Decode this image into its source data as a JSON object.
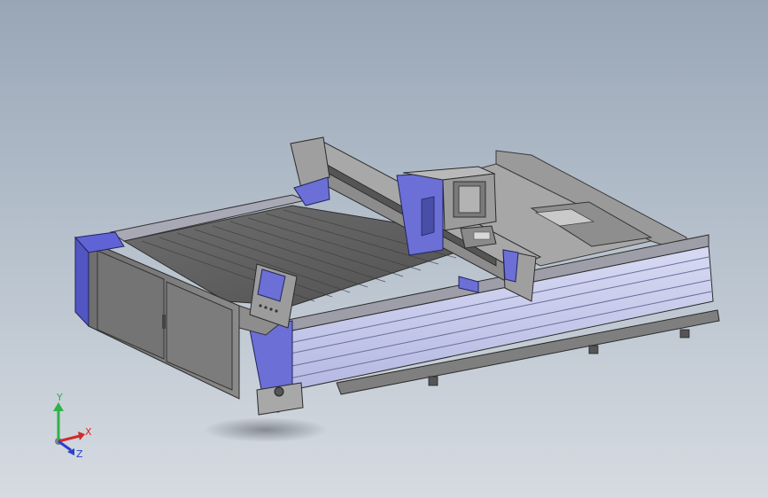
{
  "viewport": {
    "background_top": "#99a6b6",
    "background_bottom": "#d6dbe1",
    "model_accent_color": "#6b6fd6",
    "model_body_color": "#8d8d8d",
    "model_panel_color": "#c8cbec"
  },
  "triad": {
    "x_label": "X",
    "y_label": "Y",
    "z_label": "Z",
    "x_color": "#d12a2a",
    "y_color": "#2fb24a",
    "z_color": "#2a3fd1"
  }
}
